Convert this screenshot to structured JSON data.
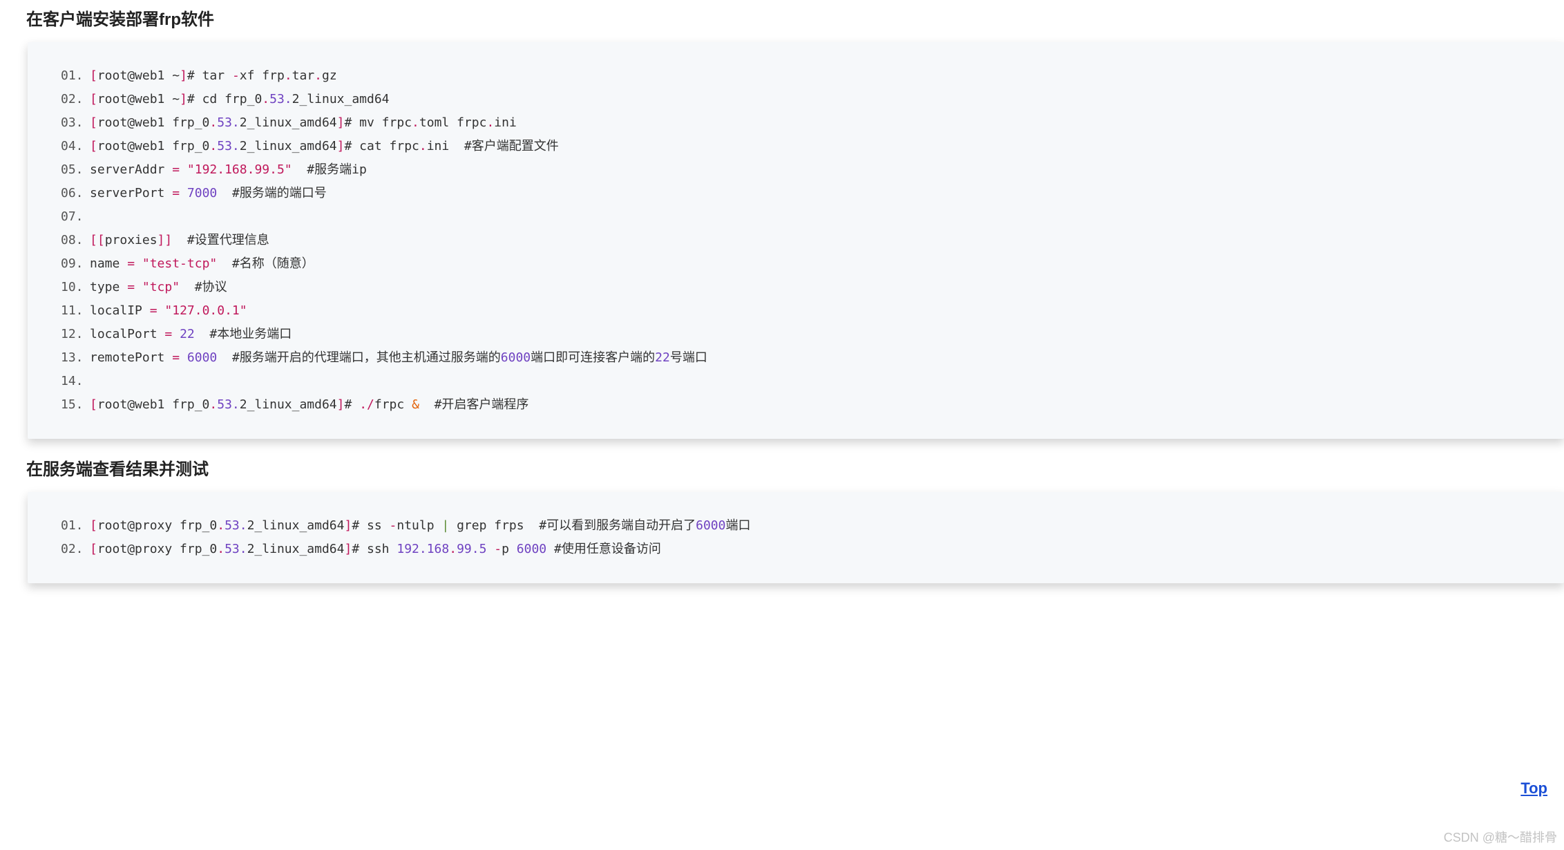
{
  "heading1": "在客户端安装部署frp软件",
  "heading2": "在服务端查看结果并测试",
  "top_label": "Top",
  "watermark": "CSDN @糖～醋排骨",
  "block1": {
    "lines": [
      {
        "n": "01.",
        "segs": [
          [
            "p",
            "["
          ],
          [
            "",
            "root@web1 ~"
          ],
          [
            "p",
            "]"
          ],
          [
            "",
            "# tar "
          ],
          [
            "p",
            "-"
          ],
          [
            "",
            "xf frp"
          ],
          [
            "p",
            "."
          ],
          [
            "",
            "tar"
          ],
          [
            "p",
            "."
          ],
          [
            "",
            "gz"
          ]
        ]
      },
      {
        "n": "02.",
        "segs": [
          [
            "p",
            "["
          ],
          [
            "",
            "root@web1 ~"
          ],
          [
            "p",
            "]"
          ],
          [
            "",
            "# cd frp_0"
          ],
          [
            "p",
            "."
          ],
          [
            "k",
            "53."
          ],
          [
            "",
            "2_linux_amd64"
          ]
        ]
      },
      {
        "n": "03.",
        "segs": [
          [
            "p",
            "["
          ],
          [
            "",
            "root@web1 frp_0"
          ],
          [
            "p",
            "."
          ],
          [
            "k",
            "53."
          ],
          [
            "",
            "2_linux_amd64"
          ],
          [
            "p",
            "]"
          ],
          [
            "",
            "# mv frpc"
          ],
          [
            "p",
            "."
          ],
          [
            "",
            "toml frpc"
          ],
          [
            "p",
            "."
          ],
          [
            "",
            "ini"
          ]
        ]
      },
      {
        "n": "04.",
        "segs": [
          [
            "p",
            "["
          ],
          [
            "",
            "root@web1 frp_0"
          ],
          [
            "p",
            "."
          ],
          [
            "k",
            "53."
          ],
          [
            "",
            "2_linux_amd64"
          ],
          [
            "p",
            "]"
          ],
          [
            "",
            "# cat frpc"
          ],
          [
            "p",
            "."
          ],
          [
            "",
            "ini  #客户端配置文件"
          ]
        ]
      },
      {
        "n": "05.",
        "segs": [
          [
            "",
            "serverAddr "
          ],
          [
            "p",
            "="
          ],
          [
            "",
            " "
          ],
          [
            "p",
            "\"192.168.99.5\""
          ],
          [
            "",
            "  #服务端ip"
          ]
        ]
      },
      {
        "n": "06.",
        "segs": [
          [
            "",
            "serverPort "
          ],
          [
            "p",
            "="
          ],
          [
            "",
            " "
          ],
          [
            "k",
            "7000"
          ],
          [
            "",
            "  #服务端的端口号"
          ]
        ]
      },
      {
        "n": "07.",
        "segs": [
          [
            "",
            ""
          ]
        ]
      },
      {
        "n": "08.",
        "segs": [
          [
            "p",
            "[["
          ],
          [
            "",
            "proxies"
          ],
          [
            "p",
            "]]"
          ],
          [
            "",
            "  #设置代理信息"
          ]
        ]
      },
      {
        "n": "09.",
        "segs": [
          [
            "",
            "name "
          ],
          [
            "p",
            "="
          ],
          [
            "",
            " "
          ],
          [
            "p",
            "\"test-tcp\""
          ],
          [
            "",
            "  #名称（随意）"
          ]
        ]
      },
      {
        "n": "10.",
        "segs": [
          [
            "",
            "type "
          ],
          [
            "p",
            "="
          ],
          [
            "",
            " "
          ],
          [
            "p",
            "\"tcp\""
          ],
          [
            "",
            "  #协议"
          ]
        ]
      },
      {
        "n": "11.",
        "segs": [
          [
            "",
            "localIP "
          ],
          [
            "p",
            "="
          ],
          [
            "",
            " "
          ],
          [
            "p",
            "\"127.0.0.1\""
          ]
        ]
      },
      {
        "n": "12.",
        "segs": [
          [
            "",
            "localPort "
          ],
          [
            "p",
            "="
          ],
          [
            "",
            " "
          ],
          [
            "k",
            "22"
          ],
          [
            "",
            "  #本地业务端口"
          ]
        ]
      },
      {
        "n": "13.",
        "segs": [
          [
            "",
            "remotePort "
          ],
          [
            "p",
            "="
          ],
          [
            "",
            " "
          ],
          [
            "k",
            "6000"
          ],
          [
            "",
            "  #服务端开启的代理端口，其他主机通过服务端的"
          ],
          [
            "k",
            "6000"
          ],
          [
            "",
            "端口即可连接客户端的"
          ],
          [
            "k",
            "22"
          ],
          [
            "",
            "号端口"
          ]
        ]
      },
      {
        "n": "14.",
        "segs": [
          [
            "",
            ""
          ]
        ]
      },
      {
        "n": "15.",
        "segs": [
          [
            "p",
            "["
          ],
          [
            "",
            "root@web1 frp_0"
          ],
          [
            "p",
            "."
          ],
          [
            "k",
            "53."
          ],
          [
            "",
            "2_linux_amd64"
          ],
          [
            "p",
            "]"
          ],
          [
            "",
            "# "
          ],
          [
            "p",
            "."
          ],
          [
            "p",
            "/"
          ],
          [
            "",
            "frpc "
          ],
          [
            "o",
            "&"
          ],
          [
            "",
            "  #开启客户端程序"
          ]
        ]
      }
    ]
  },
  "block2": {
    "lines": [
      {
        "n": "01.",
        "segs": [
          [
            "p",
            "["
          ],
          [
            "",
            "root@proxy frp_0"
          ],
          [
            "p",
            "."
          ],
          [
            "k",
            "53."
          ],
          [
            "",
            "2_linux_amd64"
          ],
          [
            "p",
            "]"
          ],
          [
            "",
            "# ss "
          ],
          [
            "p",
            "-"
          ],
          [
            "",
            "ntulp "
          ],
          [
            "g",
            "|"
          ],
          [
            "",
            " grep frps  #可以看到服务端自动开启了"
          ],
          [
            "k",
            "6000"
          ],
          [
            "",
            "端口"
          ]
        ]
      },
      {
        "n": "02.",
        "segs": [
          [
            "p",
            "["
          ],
          [
            "",
            "root@proxy frp_0"
          ],
          [
            "p",
            "."
          ],
          [
            "k",
            "53."
          ],
          [
            "",
            "2_linux_amd64"
          ],
          [
            "p",
            "]"
          ],
          [
            "",
            "# ssh "
          ],
          [
            "k",
            "192.168"
          ],
          [
            "p",
            "."
          ],
          [
            "k",
            "99.5"
          ],
          [
            "",
            " "
          ],
          [
            "p",
            "-"
          ],
          [
            "",
            "p "
          ],
          [
            "k",
            "6000"
          ],
          [
            "",
            " #使用任意设备访问"
          ]
        ]
      }
    ]
  }
}
